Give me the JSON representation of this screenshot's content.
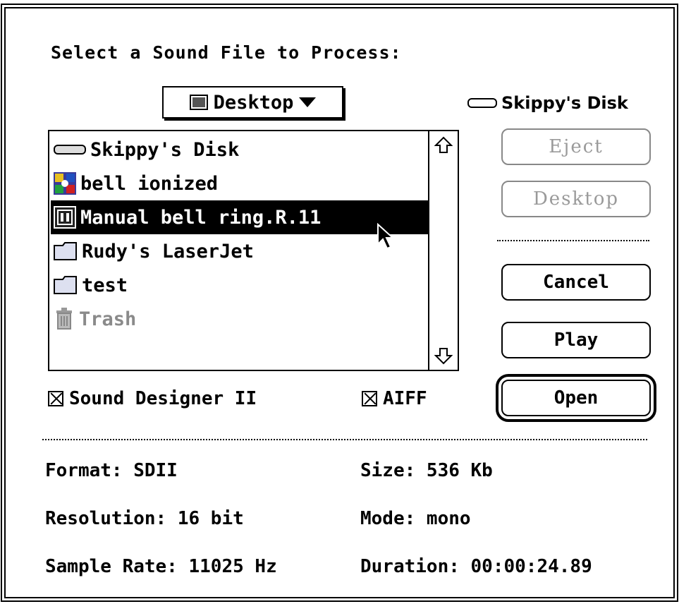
{
  "dialog": {
    "prompt": "Select a Sound File to Process:",
    "popup_label": "Desktop",
    "disk_name": "Skippy's Disk"
  },
  "file_list": [
    {
      "name": "Skippy's Disk",
      "icon": "disk-icon",
      "state": "normal"
    },
    {
      "name": "bell ionized",
      "icon": "sound-file-icon",
      "state": "normal"
    },
    {
      "name": "Manual bell ring.R.11",
      "icon": "sound-designer-file-icon",
      "state": "selected"
    },
    {
      "name": "Rudy's LaserJet",
      "icon": "folder-icon",
      "state": "normal"
    },
    {
      "name": "test",
      "icon": "folder-icon",
      "state": "normal"
    },
    {
      "name": "Trash",
      "icon": "trash-icon",
      "state": "dimmed"
    }
  ],
  "buttons": {
    "eject": "Eject",
    "desktop": "Desktop",
    "cancel": "Cancel",
    "play": "Play",
    "open": "Open"
  },
  "filters": {
    "sd2": {
      "label": "Sound Designer II",
      "checked": true
    },
    "aiff": {
      "label": "AIFF",
      "checked": true
    }
  },
  "info": {
    "format": "Format: SDII",
    "size": "Size: 536 Kb",
    "resolution": "Resolution: 16 bit",
    "mode": "Mode: mono",
    "sample_rate": "Sample Rate: 11025 Hz",
    "duration": "Duration: 00:00:24.89"
  },
  "colors": {
    "selection": "#000000",
    "disabled_text": "#9a9a9a"
  }
}
